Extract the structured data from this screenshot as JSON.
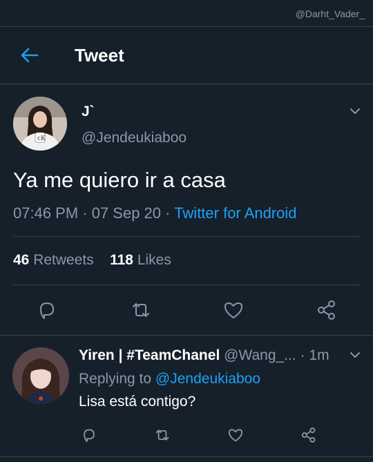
{
  "watermark": "@Darht_Vader_",
  "header": {
    "title": "Tweet"
  },
  "tweet": {
    "display_name": "J`",
    "handle": "@Jendeukiaboo",
    "text": "Ya me quiero ir a casa",
    "time": "07:46 PM · 07 Sep 20",
    "source_sep": " · ",
    "source": "Twitter for Android",
    "retweets_count": "46",
    "retweets_label": "Retweets",
    "likes_count": "118",
    "likes_label": "Likes"
  },
  "reply": {
    "display_name": "Yiren | #TeamChanel",
    "handle": "@Wang_...",
    "time": "· 1m",
    "replying_to_label": "Replying to",
    "replying_to_handle": "@Jendeukiaboo",
    "text": "Lisa está contigo?"
  },
  "colors": {
    "background": "#15202b",
    "accent": "#1da1f2",
    "secondary_text": "#8899a6",
    "divider": "#38444d"
  },
  "icons": [
    "back-arrow-icon",
    "chevron-down-icon",
    "reply-icon",
    "retweet-icon",
    "like-icon",
    "share-icon"
  ]
}
